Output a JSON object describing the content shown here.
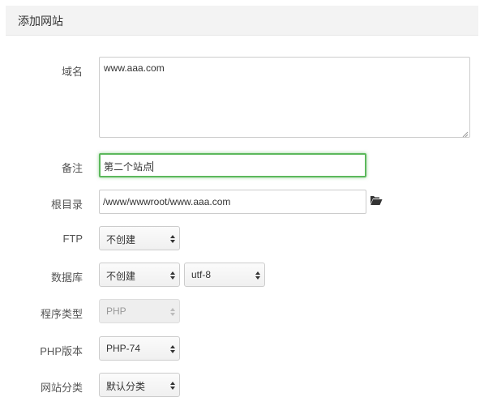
{
  "dialog": {
    "title": "添加网站"
  },
  "form": {
    "domain": {
      "label": "域名",
      "value": "www.aaa.com"
    },
    "remark": {
      "label": "备注",
      "value": "第二个站点"
    },
    "root": {
      "label": "根目录",
      "value": "/www/wwwroot/www.aaa.com",
      "icon": "folder-open-icon"
    },
    "ftp": {
      "label": "FTP",
      "selected": "不创建"
    },
    "database": {
      "label": "数据库",
      "selected": "不创建",
      "charset": "utf-8"
    },
    "program_type": {
      "label": "程序类型",
      "selected": "PHP",
      "disabled": true
    },
    "php_version": {
      "label": "PHP版本",
      "selected": "PHP-74"
    },
    "category": {
      "label": "网站分类",
      "selected": "默认分类"
    }
  },
  "colors": {
    "focus_border": "#5cb85c",
    "title_bg": "#f3f3f3",
    "disabled_text": "#999999"
  }
}
